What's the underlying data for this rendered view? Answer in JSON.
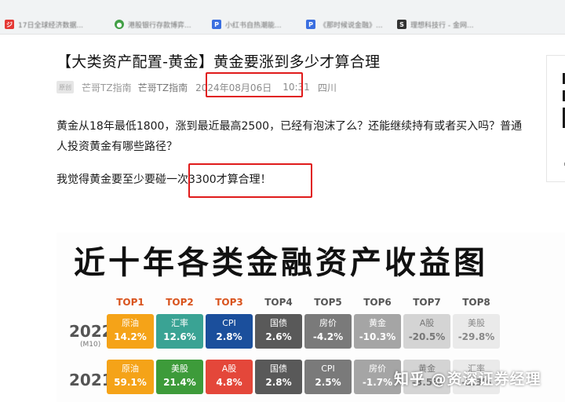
{
  "bookmarks": [
    {
      "label": "17日全球经济数据...",
      "icon": "red-logo-icon",
      "color": "#e53935"
    },
    {
      "label": "港股银行存款博弈...",
      "icon": "wechat-icon",
      "color": "#43a047"
    },
    {
      "label": "小红书自热潮能...",
      "icon": "doc-icon",
      "color": "#3b6fe0"
    },
    {
      "label": "《那时候说金融》...",
      "icon": "doc-icon",
      "color": "#3b6fe0"
    },
    {
      "label": "理想科技行 - 金网...",
      "icon": "dark-logo-icon",
      "color": "#333333"
    }
  ],
  "article": {
    "title": "【大类资产配置-黄金】黄金要涨到多少才算合理",
    "avatar_text": "原创",
    "author_faint": "芒哥TZ指南",
    "author": "芒哥TZ指南",
    "date": "2024年08月06日",
    "time": "10:31",
    "location": "四川",
    "paragraph1": "黄金从18年最低1800，涨到最近最高2500，已经有泡沫了么？还能继续持有或者买入吗？普通人投资黄金有哪些路径？",
    "paragraph2": "我觉得黄金要至少要碰一次3300才算合理！"
  },
  "infographic": {
    "title": "近十年各类金融资产收益图",
    "rank_labels": [
      "TOP1",
      "TOP2",
      "TOP3",
      "TOP4",
      "TOP5",
      "TOP6",
      "TOP7",
      "TOP8"
    ],
    "rank_colors": [
      "#d9541e",
      "#d9541e",
      "#d9541e",
      "#555555",
      "#555555",
      "#555555",
      "#555555",
      "#555555"
    ],
    "rows": [
      {
        "year": "2022",
        "sub": "(M10)",
        "cells": [
          {
            "name": "原油",
            "value": "14.2%",
            "bg": "#f5a318",
            "fg": "#ffffff"
          },
          {
            "name": "汇率",
            "value": "12.6%",
            "bg": "#3aa394",
            "fg": "#ffffff"
          },
          {
            "name": "CPI",
            "value": "2.8%",
            "bg": "#1b4f9c",
            "fg": "#ffffff"
          },
          {
            "name": "国债",
            "value": "2.6%",
            "bg": "#595959",
            "fg": "#ffffff"
          },
          {
            "name": "房价",
            "value": "-4.2%",
            "bg": "#7a7a7a",
            "fg": "#ffffff"
          },
          {
            "name": "黄金",
            "value": "-10.3%",
            "bg": "#a5a5a5",
            "fg": "#ffffff"
          },
          {
            "name": "A股",
            "value": "-20.5%",
            "bg": "#d4d4d4",
            "fg": "#777777"
          },
          {
            "name": "美股",
            "value": "-29.8%",
            "bg": "#eaeaea",
            "fg": "#888888"
          }
        ]
      },
      {
        "year": "2021",
        "sub": "",
        "cells": [
          {
            "name": "原油",
            "value": "59.1%",
            "bg": "#f5a318",
            "fg": "#ffffff"
          },
          {
            "name": "美股",
            "value": "21.4%",
            "bg": "#3d9b3a",
            "fg": "#ffffff"
          },
          {
            "name": "A股",
            "value": "4.8%",
            "bg": "#e4473a",
            "fg": "#ffffff"
          },
          {
            "name": "国债",
            "value": "2.8%",
            "bg": "#595959",
            "fg": "#ffffff"
          },
          {
            "name": "CPI",
            "value": "2.5%",
            "bg": "#7a7a7a",
            "fg": "#ffffff"
          },
          {
            "name": "房价",
            "value": "-1.7%",
            "bg": "#a5a5a5",
            "fg": "#ffffff"
          },
          {
            "name": "黄金",
            "value": "-3.5%",
            "bg": "#d4d4d4",
            "fg": "#777777"
          },
          {
            "name": "汇率",
            "value": "-2.3%",
            "bg": "#eaeaea",
            "fg": "#888888"
          }
        ]
      }
    ],
    "watermark": "知乎 @资深证券经理"
  },
  "colors": {
    "highlight_box": "#e01b1b",
    "title_text": "#121212",
    "meta_text": "#8a8a8a"
  }
}
